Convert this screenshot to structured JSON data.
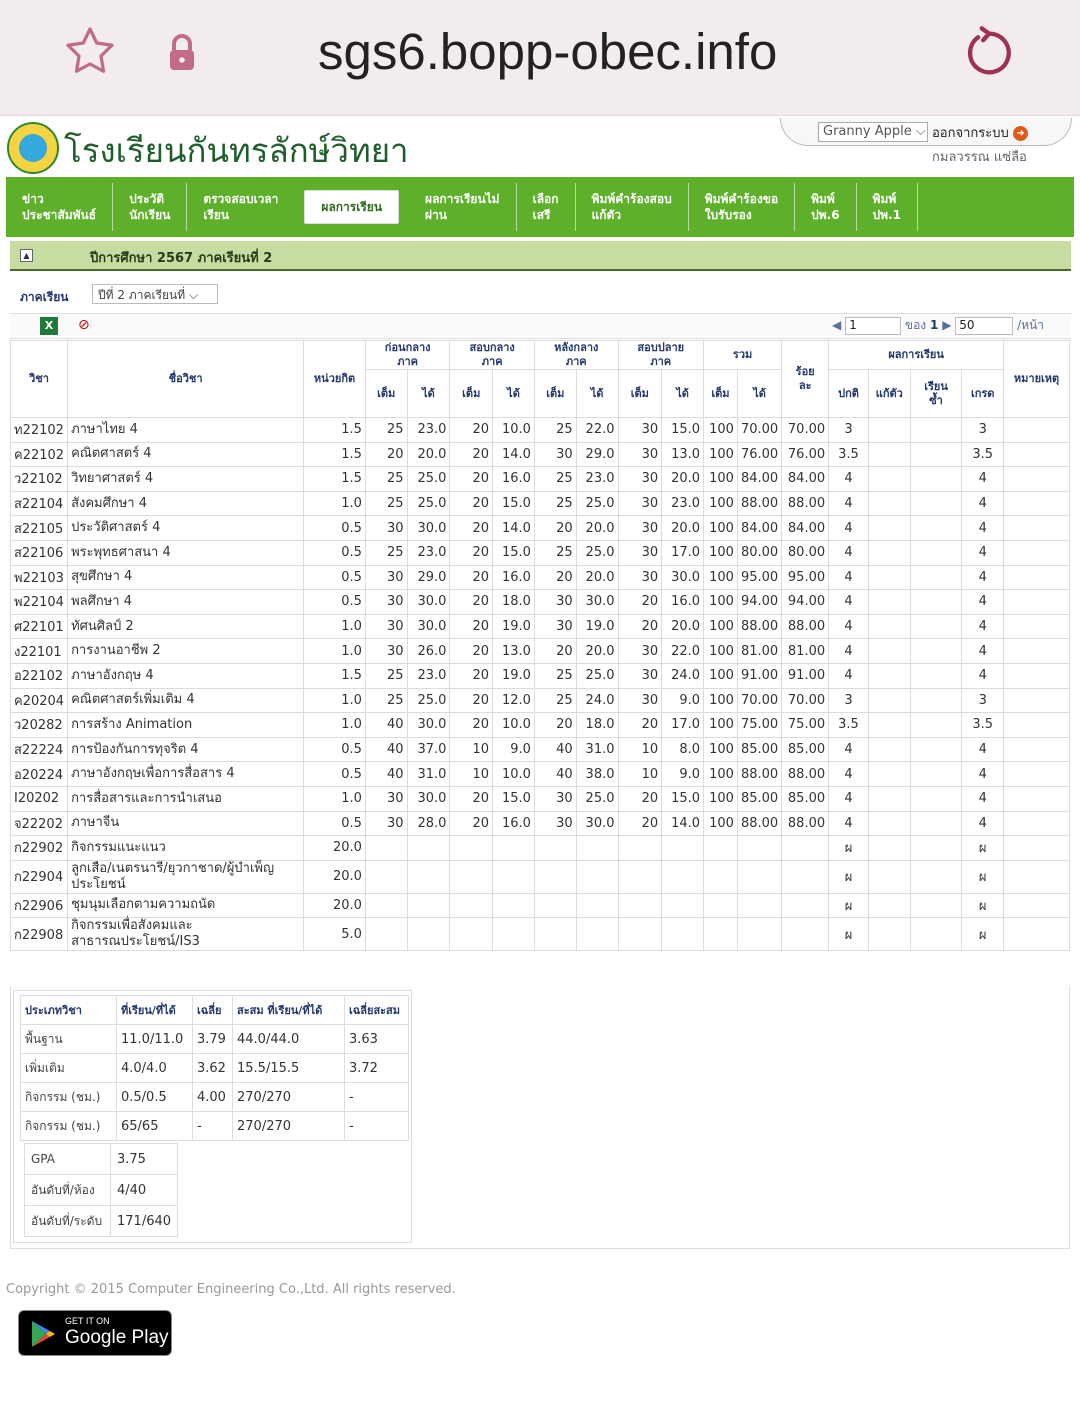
{
  "browser": {
    "url": "sgs6.bopp-obec.info"
  },
  "header": {
    "school_name": "โรงเรียนกันทรลักษ์วิทยา",
    "user_select": "Granny Apple",
    "logout": "ออกจากระบบ",
    "user_name": "กมลวรรณ  แซ่ลือ"
  },
  "nav": [
    {
      "label": "ข่าว\nประชาสัมพันธ์",
      "active": false
    },
    {
      "label": "ประวัติ\nนักเรียน",
      "active": false
    },
    {
      "label": "ตรวจสอบเวลา\nเรียน",
      "active": false
    },
    {
      "label": "ผลการเรียน",
      "active": true
    },
    {
      "label": "ผลการเรียนไม่\nผ่าน",
      "active": false
    },
    {
      "label": "เลือก\nเสรี",
      "active": false
    },
    {
      "label": "พิมพ์คำร้องสอบ\nแก้ตัว",
      "active": false
    },
    {
      "label": "พิมพ์คำร้องขอ\nใบรับรอง",
      "active": false
    },
    {
      "label": "พิมพ์\nปพ.6",
      "active": false
    },
    {
      "label": "พิมพ์\nปพ.1",
      "active": false
    }
  ],
  "year_bar": {
    "text": "ปีการศึกษา  2567  ภาคเรียนที่  2"
  },
  "semester": {
    "label": "ภาคเรียน",
    "value": "ปีที่  2  ภาคเรียนที่"
  },
  "pager": {
    "page": "1",
    "of_label": "ของ",
    "total": "1",
    "per_page": "50",
    "per_label": "/หน้า"
  },
  "table": {
    "h": {
      "code": "วิชา",
      "name": "ชื่อวิชา",
      "credit": "หน่วยกิต",
      "g1": "ก่อนกลาง\nภาค",
      "g2": "สอบกลาง\nภาค",
      "g3": "หลังกลาง\nภาค",
      "g4": "สอบปลาย\nภาค",
      "g5": "รวม",
      "pct": "ร้อย\nละ",
      "result": "ผลการเรียน",
      "remark": "หมายเหตุ",
      "full": "เต็ม",
      "got": "ได้",
      "normal": "ปกติ",
      "fix": "แก้ตัว",
      "repeat": "เรียน\nซ้ำ",
      "grade": "เกรด"
    },
    "rows": [
      [
        "ท22102",
        "ภาษาไทย  4",
        "1.5",
        "25",
        "23.0",
        "20",
        "10.0",
        "25",
        "22.0",
        "30",
        "15.0",
        "100",
        "70.00",
        "70.00",
        "3",
        "",
        "",
        "3",
        ""
      ],
      [
        "ค22102",
        "คณิตศาสตร์  4",
        "1.5",
        "20",
        "20.0",
        "20",
        "14.0",
        "30",
        "29.0",
        "30",
        "13.0",
        "100",
        "76.00",
        "76.00",
        "3.5",
        "",
        "",
        "3.5",
        ""
      ],
      [
        "ว22102",
        "วิทยาศาสตร์  4",
        "1.5",
        "25",
        "25.0",
        "20",
        "16.0",
        "25",
        "23.0",
        "30",
        "20.0",
        "100",
        "84.00",
        "84.00",
        "4",
        "",
        "",
        "4",
        ""
      ],
      [
        "ส22104",
        "สังคมศึกษา  4",
        "1.0",
        "25",
        "25.0",
        "20",
        "15.0",
        "25",
        "25.0",
        "30",
        "23.0",
        "100",
        "88.00",
        "88.00",
        "4",
        "",
        "",
        "4",
        ""
      ],
      [
        "ส22105",
        "ประวัติศาสตร์  4",
        "0.5",
        "30",
        "30.0",
        "20",
        "14.0",
        "20",
        "20.0",
        "30",
        "20.0",
        "100",
        "84.00",
        "84.00",
        "4",
        "",
        "",
        "4",
        ""
      ],
      [
        "ส22106",
        "พระพุทธศาสนา  4",
        "0.5",
        "25",
        "23.0",
        "20",
        "15.0",
        "25",
        "25.0",
        "30",
        "17.0",
        "100",
        "80.00",
        "80.00",
        "4",
        "",
        "",
        "4",
        ""
      ],
      [
        "พ22103",
        "สุขศึกษา  4",
        "0.5",
        "30",
        "29.0",
        "20",
        "16.0",
        "20",
        "20.0",
        "30",
        "30.0",
        "100",
        "95.00",
        "95.00",
        "4",
        "",
        "",
        "4",
        ""
      ],
      [
        "พ22104",
        "พลศึกษา  4",
        "0.5",
        "30",
        "30.0",
        "20",
        "18.0",
        "30",
        "30.0",
        "20",
        "16.0",
        "100",
        "94.00",
        "94.00",
        "4",
        "",
        "",
        "4",
        ""
      ],
      [
        "ศ22101",
        "ทัศนศิลป์  2",
        "1.0",
        "30",
        "30.0",
        "20",
        "19.0",
        "30",
        "19.0",
        "20",
        "20.0",
        "100",
        "88.00",
        "88.00",
        "4",
        "",
        "",
        "4",
        ""
      ],
      [
        "ง22101",
        "การงานอาชีพ  2",
        "1.0",
        "30",
        "26.0",
        "20",
        "13.0",
        "20",
        "20.0",
        "30",
        "22.0",
        "100",
        "81.00",
        "81.00",
        "4",
        "",
        "",
        "4",
        ""
      ],
      [
        "อ22102",
        "ภาษาอังกฤษ  4",
        "1.5",
        "25",
        "23.0",
        "20",
        "19.0",
        "25",
        "25.0",
        "30",
        "24.0",
        "100",
        "91.00",
        "91.00",
        "4",
        "",
        "",
        "4",
        ""
      ],
      [
        "ค20204",
        "คณิตศาสตร์เพิ่มเติม  4",
        "1.0",
        "25",
        "25.0",
        "20",
        "12.0",
        "25",
        "24.0",
        "30",
        "9.0",
        "100",
        "70.00",
        "70.00",
        "3",
        "",
        "",
        "3",
        ""
      ],
      [
        "ว20282",
        "การสร้าง  Animation",
        "1.0",
        "40",
        "30.0",
        "20",
        "10.0",
        "20",
        "18.0",
        "20",
        "17.0",
        "100",
        "75.00",
        "75.00",
        "3.5",
        "",
        "",
        "3.5",
        ""
      ],
      [
        "ส22224",
        "การป้องกันการทุจริต  4",
        "0.5",
        "40",
        "37.0",
        "10",
        "9.0",
        "40",
        "31.0",
        "10",
        "8.0",
        "100",
        "85.00",
        "85.00",
        "4",
        "",
        "",
        "4",
        ""
      ],
      [
        "อ20224",
        "ภาษาอังกฤษเพื่อการสื่อสาร  4",
        "0.5",
        "40",
        "31.0",
        "10",
        "10.0",
        "40",
        "38.0",
        "10",
        "9.0",
        "100",
        "88.00",
        "88.00",
        "4",
        "",
        "",
        "4",
        ""
      ],
      [
        "I20202",
        "การสื่อสารและการนำเสนอ",
        "1.0",
        "30",
        "30.0",
        "20",
        "15.0",
        "30",
        "25.0",
        "20",
        "15.0",
        "100",
        "85.00",
        "85.00",
        "4",
        "",
        "",
        "4",
        ""
      ],
      [
        "จ22202",
        "ภาษาจีน",
        "0.5",
        "30",
        "28.0",
        "20",
        "16.0",
        "30",
        "30.0",
        "20",
        "14.0",
        "100",
        "88.00",
        "88.00",
        "4",
        "",
        "",
        "4",
        ""
      ],
      [
        "ก22902",
        "กิจกรรมแนะแนว",
        "20.0",
        "",
        "",
        "",
        "",
        "",
        "",
        "",
        "",
        "",
        "",
        "",
        "ผ",
        "",
        "",
        "ผ",
        ""
      ],
      [
        "ก22904",
        "ลูกเสือ/เนตรนารี/ยุวกาชาด/ผู้บำเพ็ญประโยชน์",
        "20.0",
        "",
        "",
        "",
        "",
        "",
        "",
        "",
        "",
        "",
        "",
        "",
        "ผ",
        "",
        "",
        "ผ",
        ""
      ],
      [
        "ก22906",
        "ชุมนุมเลือกตามความถนัด",
        "20.0",
        "",
        "",
        "",
        "",
        "",
        "",
        "",
        "",
        "",
        "",
        "",
        "ผ",
        "",
        "",
        "ผ",
        ""
      ],
      [
        "ก22908",
        "กิจกรรมเพื่อสังคมและสาธารณประโยชน์/IS3",
        "5.0",
        "",
        "",
        "",
        "",
        "",
        "",
        "",
        "",
        "",
        "",
        "",
        "ผ",
        "",
        "",
        "ผ",
        ""
      ]
    ]
  },
  "summary": {
    "headers": [
      "ประเภทวิชา",
      "ที่เรียน/ที่ได้",
      "เฉลี่ย",
      "สะสม  ที่เรียน/ที่ได้",
      "เฉลี่ยสะสม"
    ],
    "rows": [
      [
        "พื้นฐาน",
        "11.0/11.0",
        "3.79",
        "44.0/44.0",
        "3.63"
      ],
      [
        "เพิ่มเติม",
        "4.0/4.0",
        "3.62",
        "15.5/15.5",
        "3.72"
      ],
      [
        "กิจกรรม  (ชม.)",
        "0.5/0.5",
        "4.00",
        "270/270",
        "-"
      ],
      [
        "กิจกรรม  (ชม.)",
        "65/65",
        "-",
        "270/270",
        "-"
      ]
    ],
    "gpa": [
      [
        "GPA",
        "3.75"
      ],
      [
        "อันดับที่/ห้อง",
        "4/40"
      ],
      [
        "อันดับที่/ระดับ",
        "171/640"
      ]
    ]
  },
  "footer": {
    "copyright": "Copyright © 2015 Computer Engineering Co.,Ltd. All rights reserved.",
    "badge_small": "GET IT ON",
    "badge_big": "Google Play"
  }
}
